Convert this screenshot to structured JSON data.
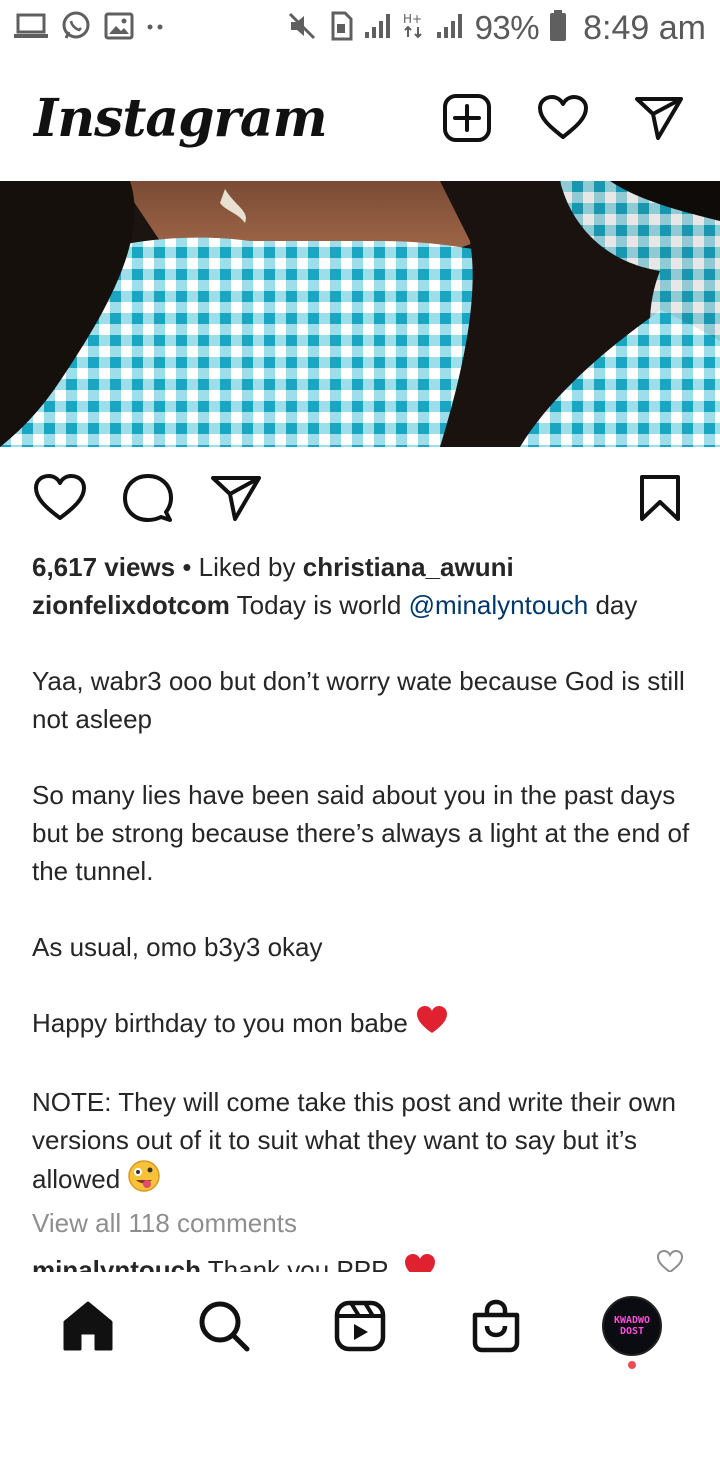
{
  "status_bar": {
    "battery": "93%",
    "time": "8:49 am"
  },
  "header": {
    "logo": "Instagram"
  },
  "post": {
    "views": "6,617 views",
    "liked_by_prefix": " • Liked by ",
    "liked_by_user": "christiana_awuni",
    "author": "zionfelixdotcom",
    "caption_start": " Today is world ",
    "caption_mention": "@minalyntouch",
    "caption_end": " day",
    "paragraphs": [
      "Yaa, wabr3 ooo but don’t worry wate because God is still not asleep",
      "So many lies have been said about you in the past days but be strong because there’s always a light at the end of the tunnel.",
      "As usual, omo b3y3 okay",
      "Happy birthday to you mon babe",
      "NOTE: They will come take this post and write their own versions out of it to suit what they want to say but it’s allowed"
    ],
    "view_comments": "View all 118 comments",
    "comment_user": "minalyntouch",
    "comment_text": " Thank you PPP"
  },
  "profile_avatar": {
    "line1": "KWADWO",
    "line2": "DOST"
  },
  "colors": {
    "mention": "#00376b",
    "notification_dot": "#ed4956"
  }
}
